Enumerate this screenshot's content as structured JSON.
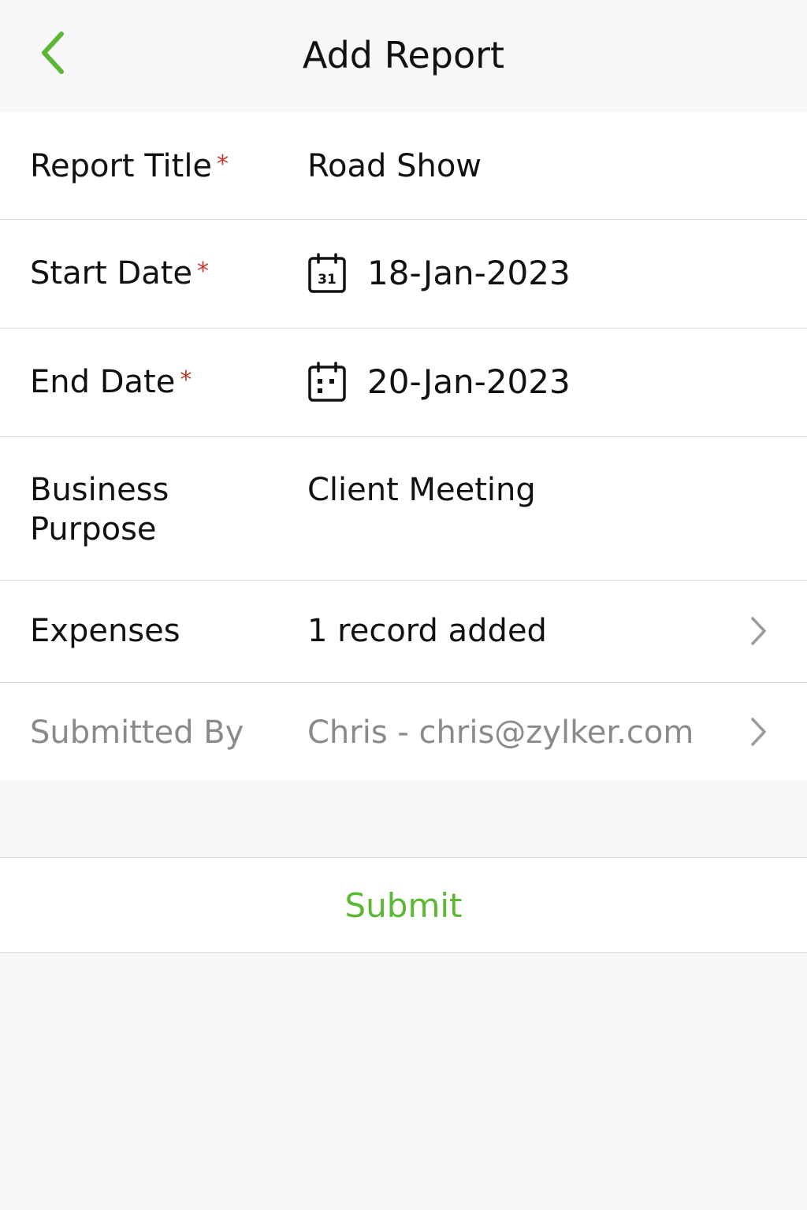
{
  "header": {
    "title": "Add Report",
    "back_icon": "chevron-left-icon"
  },
  "colors": {
    "accent": "#5ab834",
    "required": "#c0392b",
    "muted": "#8a8a8e",
    "background": "#f7f7fa"
  },
  "form": {
    "report_title": {
      "label": "Report Title",
      "required_mark": "*",
      "value": "Road Show"
    },
    "start_date": {
      "label": "Start Date",
      "required_mark": "*",
      "value": "18-Jan-2023",
      "icon": "calendar-icon",
      "icon_text": "31"
    },
    "end_date": {
      "label": "End Date",
      "required_mark": "*",
      "value": "20-Jan-2023",
      "icon": "calendar-icon"
    },
    "business_purpose": {
      "label": "Business Purpose",
      "value": "Client Meeting"
    },
    "expenses": {
      "label": "Expenses",
      "value": "1 record added",
      "icon": "chevron-right-icon"
    },
    "submitted_by": {
      "label": "Submitted By",
      "value": "Chris - chris@zylker.com",
      "icon": "chevron-right-icon"
    }
  },
  "actions": {
    "submit_label": "Submit"
  }
}
